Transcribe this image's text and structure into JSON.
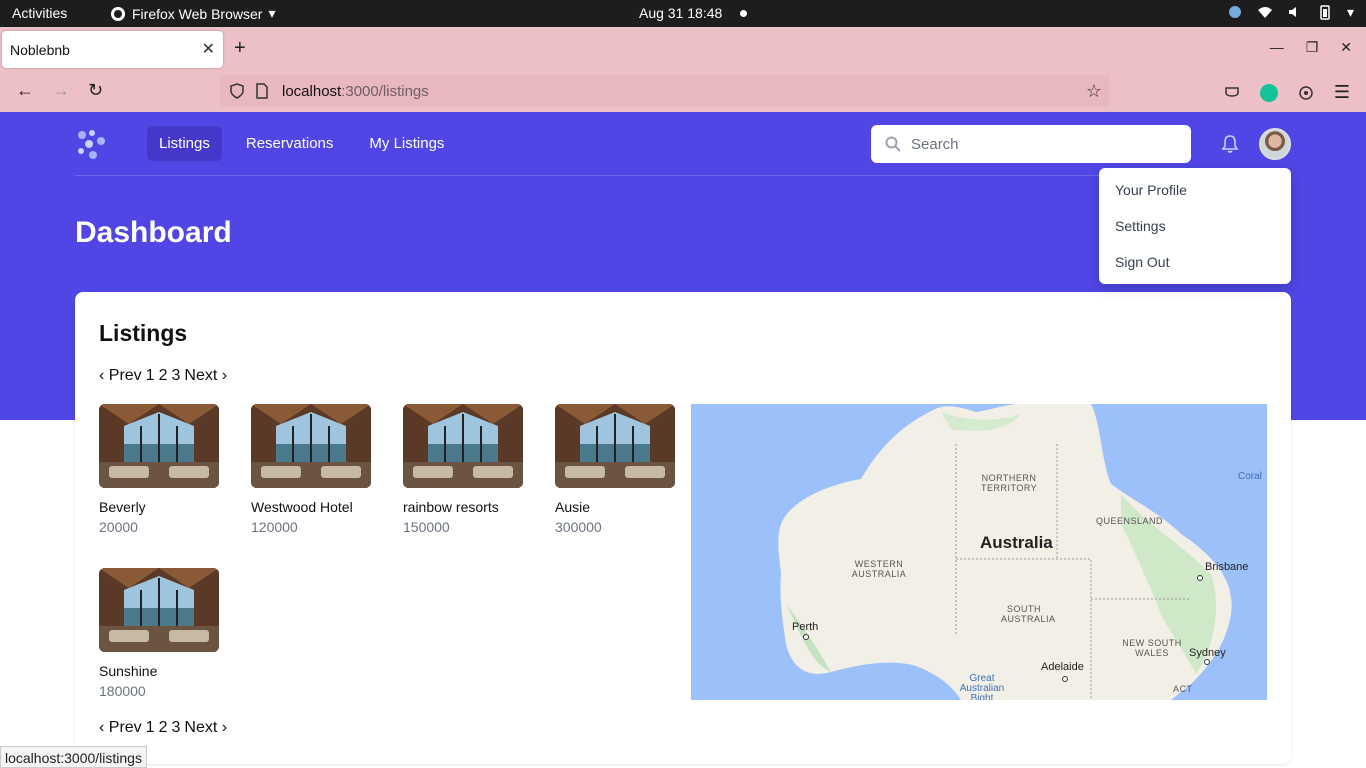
{
  "os": {
    "activities": "Activities",
    "app_name": "Firefox Web Browser",
    "clock": "Aug 31  18:48"
  },
  "browser": {
    "tab_title": "Noblebnb",
    "url_host": "localhost",
    "url_path": ":3000/listings",
    "status_url": "localhost:3000/listings"
  },
  "nav": {
    "items": [
      "Listings",
      "Reservations",
      "My Listings"
    ],
    "search_placeholder": "Search"
  },
  "dropdown": {
    "items": [
      "Your Profile",
      "Settings",
      "Sign Out"
    ]
  },
  "page": {
    "title": "Dashboard",
    "section_title": "Listings"
  },
  "pagination": {
    "prev": "‹ Prev",
    "pages": [
      "1",
      "2",
      "3"
    ],
    "next": "Next ›"
  },
  "listings": [
    {
      "name": "Beverly",
      "price": "20000"
    },
    {
      "name": "Westwood Hotel",
      "price": "120000"
    },
    {
      "name": "rainbow resorts",
      "price": "150000"
    },
    {
      "name": "Ausie",
      "price": "300000"
    },
    {
      "name": "Sunshine",
      "price": "180000"
    }
  ],
  "map": {
    "country": "Australia",
    "regions": [
      "NORTHERN TERRITORY",
      "QUEENSLAND",
      "WESTERN AUSTRALIA",
      "SOUTH AUSTRALIA",
      "NEW SOUTH WALES",
      "ACT"
    ],
    "cities": [
      "Brisbane",
      "Perth",
      "Sydney",
      "Adelaide"
    ],
    "water": [
      "Coral",
      "Great Australian Bight"
    ]
  },
  "colors": {
    "brand": "#4f46e5",
    "brand_active": "#4338ca",
    "tabbar": "#edbfc6"
  }
}
